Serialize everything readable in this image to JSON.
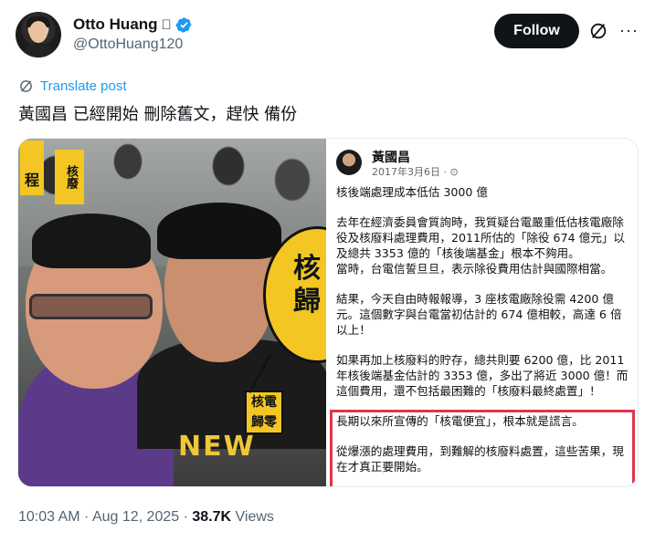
{
  "author": {
    "display_name": "Otto Huang",
    "handle": "@OttoHuang120",
    "verified_color": "#1d9bf0"
  },
  "actions": {
    "follow_label": "Follow",
    "more_label": "···"
  },
  "translate_label": "Translate post",
  "post_text": "黃國昌 已經開始 刪除舊文，趕快 備份",
  "media": {
    "photo": {
      "sign_left": "程",
      "sign_mid": "核廢",
      "zoom_sign_text": "核\n歸",
      "badge_text": "核電\n歸零",
      "shirt_text": "NEW"
    },
    "screenshot": {
      "name": "黃國昌",
      "date": "2017年3月6日 · ⊙",
      "paragraphs": [
        "核後端處理成本低估 3000 億",
        "去年在經濟委員會質詢時，我質疑台電嚴重低估核電廠除役及核廢料處理費用，2011所估的「除役 674 億元」以及總共 3353 億的「核後端基金」根本不夠用。\n當時，台電信誓旦旦，表示除役費用估計與國際相當。",
        "結果，今天自由時報報導，3 座核電廠除役需 4200 億元。這個數字與台電當初估計的 674 億相較，高達 6 倍以上！",
        "如果再加上核廢料的貯存，總共則要 6200 億，比 2011 年核後端基金估計的 3353 億，多出了將近 3000 億！而這個費用，還不包括最困難的「核廢料最終處置」！",
        "長期以來所宣傳的「核電便宜」，根本就是謊言。",
        "從爆漲的處理費用，到難解的核廢料處置，這些苦果，現在才真正要開始。"
      ],
      "highlight_color": "#e0344b"
    }
  },
  "footer": {
    "time": "10:03 AM",
    "separator": " · ",
    "date": "Aug 12, 2025",
    "separator2": " · ",
    "views_count": "38.7K",
    "views_label": " Views"
  }
}
